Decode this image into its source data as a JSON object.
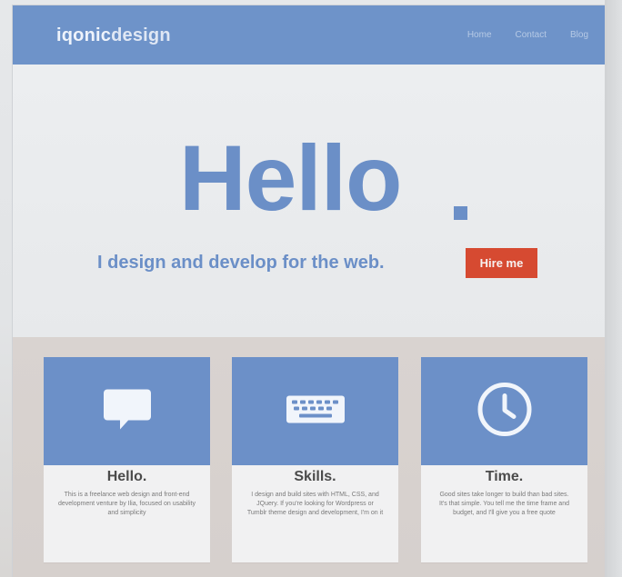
{
  "header": {
    "brand_prefix": "iqonic",
    "brand_suffix": "design",
    "nav": [
      "Home",
      "Contact",
      "Blog"
    ]
  },
  "hero": {
    "headline": "Hello",
    "tagline": "I design and develop for the web.",
    "cta": "Hire me"
  },
  "cards": [
    {
      "title": "Hello.",
      "icon": "speech-bubble-icon",
      "text": "This is a freelance web design and front-end development venture by Ilia, focused on usability and simplicity"
    },
    {
      "title": "Skills.",
      "icon": "keyboard-icon",
      "text": "I design and build sites with HTML, CSS, and JQuery. If you're looking for Wordpress or Tumblr theme design and development, I'm on it"
    },
    {
      "title": "Time.",
      "icon": "clock-icon",
      "text": "Good sites take longer to build than bad sites. It's that simple. You tell me the time frame and budget, and I'll give you a free quote"
    }
  ],
  "colors": {
    "brand_blue": "#6e93c9",
    "cta_red": "#d64a31",
    "page_bg": "#e8eaec",
    "card_bg": "#f1f1f2"
  }
}
